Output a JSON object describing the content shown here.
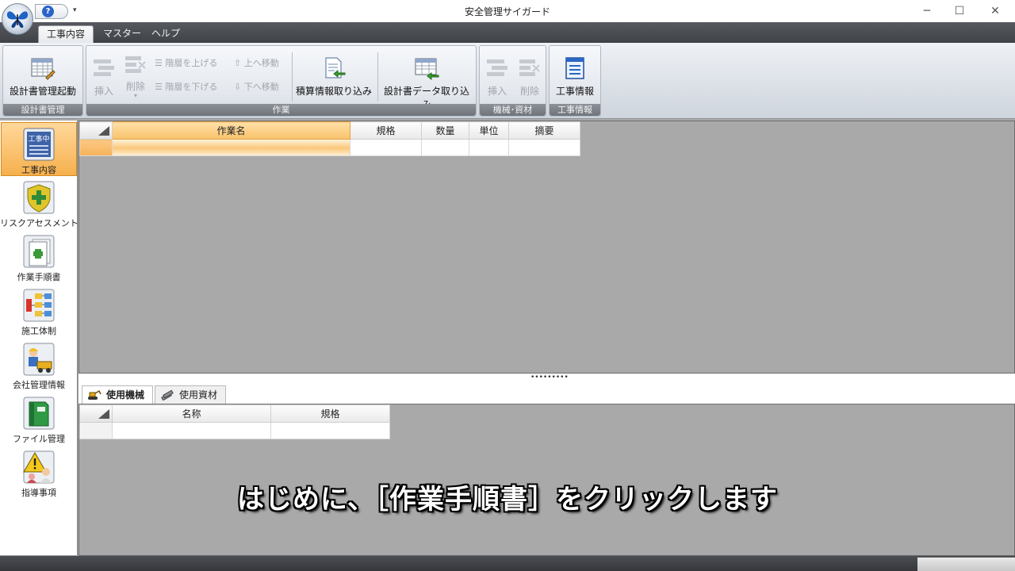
{
  "window": {
    "title": "安全管理サイガード",
    "qat_dropdown_glyph": "▾",
    "help_glyph": "?",
    "minimize_glyph": "─",
    "maximize_glyph": "☐",
    "close_glyph": "✕"
  },
  "menu_tabs": [
    "工事内容",
    "マスター",
    "ヘルプ"
  ],
  "ribbon": {
    "groups": {
      "design": "設計書管理",
      "work": "作業",
      "machines": "機械･資材",
      "info": "工事情報"
    },
    "buttons": {
      "design_start": "設計書管理起動",
      "insert": "挿入",
      "delete": "削除",
      "delete_arrow": "▾",
      "level_up": "階層を上げる",
      "level_down": "階層を下げる",
      "move_up": "上へ移動",
      "move_down": "下へ移動",
      "estimate_import": "積算情報取り込み",
      "design_data_import": "設計書データ取り込み",
      "machine_insert": "挿入",
      "machine_delete": "削除",
      "construction_info": "工事情報"
    }
  },
  "left_nav": [
    {
      "label": "工事内容",
      "active": true
    },
    {
      "label": "リスクアセスメント",
      "active": false
    },
    {
      "label": "作業手順書",
      "active": false
    },
    {
      "label": "施工体制",
      "active": false
    },
    {
      "label": "会社管理情報",
      "active": false
    },
    {
      "label": "ファイル管理",
      "active": false
    },
    {
      "label": "指導事項",
      "active": false
    }
  ],
  "nav_icon_text": {
    "koji_badge": "工事中"
  },
  "work_grid": {
    "columns": [
      "作業名",
      "規格",
      "数量",
      "単位",
      "摘要"
    ]
  },
  "bottom_tabs": [
    "使用機械",
    "使用資材"
  ],
  "material_grid": {
    "columns": [
      "名称",
      "規格"
    ]
  },
  "splitter_grip": "•••••••••",
  "caption": "はじめに、［作業手順書］をクリックします"
}
